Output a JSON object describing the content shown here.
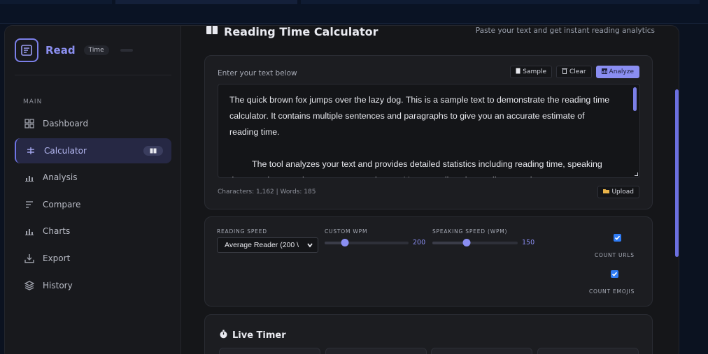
{
  "brand": {
    "name": "Read",
    "tag": "Time"
  },
  "sidebar": {
    "section": "MAIN",
    "items": [
      {
        "label": "Dashboard",
        "icon": "grid-icon"
      },
      {
        "label": "Calculator",
        "icon": "calculator-icon",
        "active": true,
        "badge_icon": "book-icon"
      },
      {
        "label": "Analysis",
        "icon": "bar-chart-icon"
      },
      {
        "label": "Compare",
        "icon": "compare-icon"
      },
      {
        "label": "Charts",
        "icon": "chart-icon"
      },
      {
        "label": "Export",
        "icon": "download-icon"
      },
      {
        "label": "History",
        "icon": "layers-icon"
      }
    ]
  },
  "header": {
    "title": "Reading Time Calculator",
    "subtitle": "Paste your text and get instant reading analytics"
  },
  "input_card": {
    "label": "Enter your text below",
    "buttons": {
      "sample": "Sample",
      "clear": "Clear",
      "analyze": "Analyze",
      "upload": "Upload"
    },
    "paragraphs": [
      "The quick brown fox jumps over the lazy dog. This is a sample text to demonstrate the reading time calculator. It contains multiple sentences and paragraphs to give you an accurate estimate of reading time.",
      "The tool analyzes your text and provides detailed statistics including reading time, speaking time, word count, character count, and more. You can adjust the reading speed"
    ],
    "counts": "Characters: 1,162 | Words: 185"
  },
  "settings": {
    "reading_speed_label": "READING SPEED",
    "reading_speed_value": "Average Reader (200 \\",
    "custom_wpm_label": "CUSTOM WPM",
    "custom_wpm_value": "200",
    "custom_wpm_fraction": 0.24,
    "speaking_speed_label": "SPEAKING SPEED (WPM)",
    "speaking_speed_value": "150",
    "speaking_speed_fraction": 0.4,
    "count_urls_label": "COUNT URLS",
    "count_emojis_label": "COUNT EMOJIS"
  },
  "timer": {
    "title": "Live Timer"
  },
  "colors": {
    "accent": "#8a8ef2",
    "checkbox": "#2f7cf5",
    "background": "#151619"
  }
}
